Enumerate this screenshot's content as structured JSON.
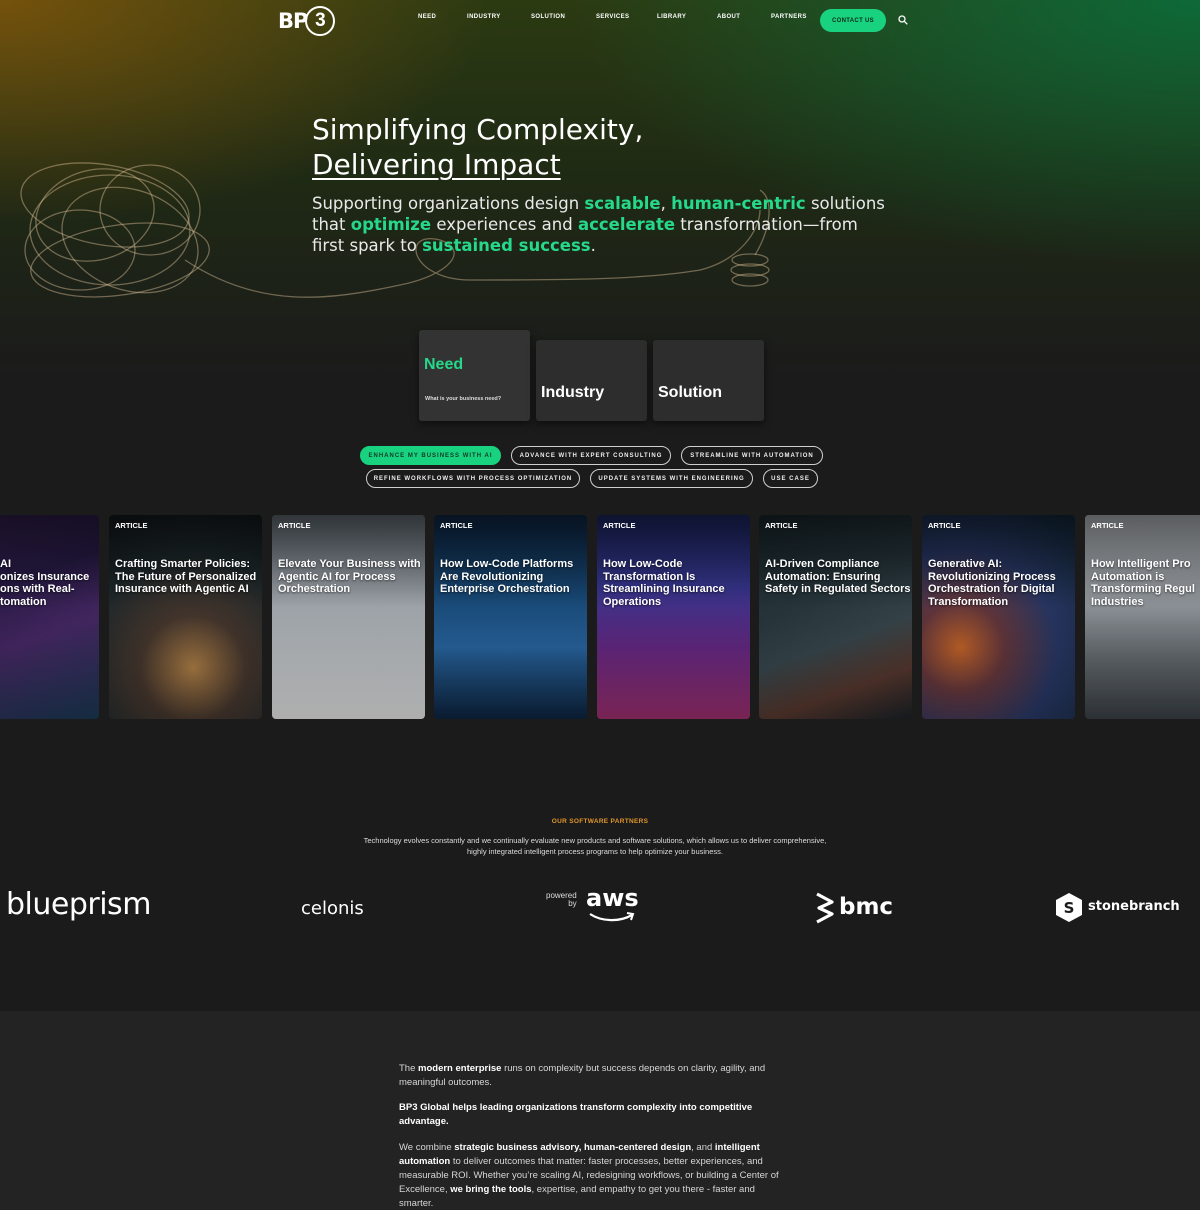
{
  "nav": {
    "logo": "BP3",
    "items": [
      "NEED",
      "INDUSTRY",
      "SOLUTION",
      "SERVICES",
      "LIBRARY",
      "ABOUT",
      "PARTNERS"
    ],
    "contact": "CONTACT US",
    "search_icon": "search-icon"
  },
  "hero": {
    "headline_line1": "Simplifying Complexity,",
    "headline_line2": "Delivering Impact",
    "sub": [
      {
        "t": "Supporting organizations design ",
        "h": false
      },
      {
        "t": "scalable",
        "h": true
      },
      {
        "t": ", ",
        "h": false
      },
      {
        "t": "human-centric",
        "h": true
      },
      {
        "t": " solutions that ",
        "h": false
      },
      {
        "t": "optimize",
        "h": true
      },
      {
        "t": " experiences and ",
        "h": false
      },
      {
        "t": "accelerate",
        "h": true
      },
      {
        "t": " transformation—from first spark to ",
        "h": false
      },
      {
        "t": "sustained success",
        "h": true
      },
      {
        "t": ".",
        "h": false
      }
    ],
    "accent_color": "#26d98a"
  },
  "selector": {
    "cards": [
      {
        "title": "Need",
        "subtitle": "What is your business need?",
        "active": true
      },
      {
        "title": "Industry",
        "subtitle": "",
        "active": false
      },
      {
        "title": "Solution",
        "subtitle": "",
        "active": false
      }
    ]
  },
  "pills": [
    {
      "label": "ENHANCE MY BUSINESS WITH AI",
      "active": true
    },
    {
      "label": "ADVANCE WITH EXPERT CONSULTING",
      "active": false
    },
    {
      "label": "STREAMLINE WITH AUTOMATION",
      "active": false
    },
    {
      "label": "REFINE WORKFLOWS WITH PROCESS OPTIMIZATION",
      "active": false
    },
    {
      "label": "UPDATE SYSTEMS WITH ENGINEERING",
      "active": false
    },
    {
      "label": "USE CASE",
      "active": false
    }
  ],
  "articles": [
    {
      "tag": "",
      "title": "AI\nonizes Insurance\nons with Real-\ntomation"
    },
    {
      "tag": "ARTICLE",
      "title": "Crafting Smarter Policies: The Future of Personalized Insurance with Agentic AI"
    },
    {
      "tag": "ARTICLE",
      "title": "Elevate Your Business with Agentic AI for Process Orchestration"
    },
    {
      "tag": "ARTICLE",
      "title": "How Low-Code Platforms Are Revolutionizing Enterprise Orchestration"
    },
    {
      "tag": "ARTICLE",
      "title": "How Low-Code Transformation Is Streamlining Insurance Operations"
    },
    {
      "tag": "ARTICLE",
      "title": "AI-Driven Compliance Automation: Ensuring Safety in Regulated Sectors"
    },
    {
      "tag": "ARTICLE",
      "title": "Generative AI: Revolutionizing Process Orchestration for Digital Transformation"
    },
    {
      "tag": "ARTICLE",
      "title": "How Intelligent Pro Automation is Transforming Regul Industries"
    }
  ],
  "partners": {
    "eyebrow": "OUR SOFTWARE PARTNERS",
    "description": "Technology evolves constantly and we continually evaluate new products and software solutions, which allows us to deliver comprehensive, highly integrated intelligent process programs to help optimize your business.",
    "logos": {
      "blueprism": "blueprism",
      "celonis": "celonis",
      "aws_powered": "powered\nby",
      "aws": "aws",
      "bmc": "bmc",
      "stonebranch": "stonebranch"
    }
  },
  "about": {
    "p1": [
      {
        "t": "The ",
        "b": false
      },
      {
        "t": "modern enterprise",
        "b": true
      },
      {
        "t": " runs on complexity but success depends on clarity, agility, and meaningful outcomes.",
        "b": false
      }
    ],
    "p2": [
      {
        "t": "BP3 Global helps leading organizations transform complexity into competitive advantage.",
        "b": true
      }
    ],
    "p3": [
      {
        "t": "We combine ",
        "b": false
      },
      {
        "t": "strategic business advisory",
        "b": true
      },
      {
        "t": ", human-centered design",
        "b": true
      },
      {
        "t": ", and ",
        "b": false
      },
      {
        "t": "intelligent automation",
        "b": true
      },
      {
        "t": " to deliver outcomes that matter: faster processes, better experiences, and measurable ROI. Whether you’re scaling AI, redesigning workflows, or building a Center of Excellence, ",
        "b": false
      },
      {
        "t": "we bring the tools",
        "b": true
      },
      {
        "t": ", expertise, and empathy to get you there - faster and smarter.",
        "b": false
      }
    ]
  }
}
